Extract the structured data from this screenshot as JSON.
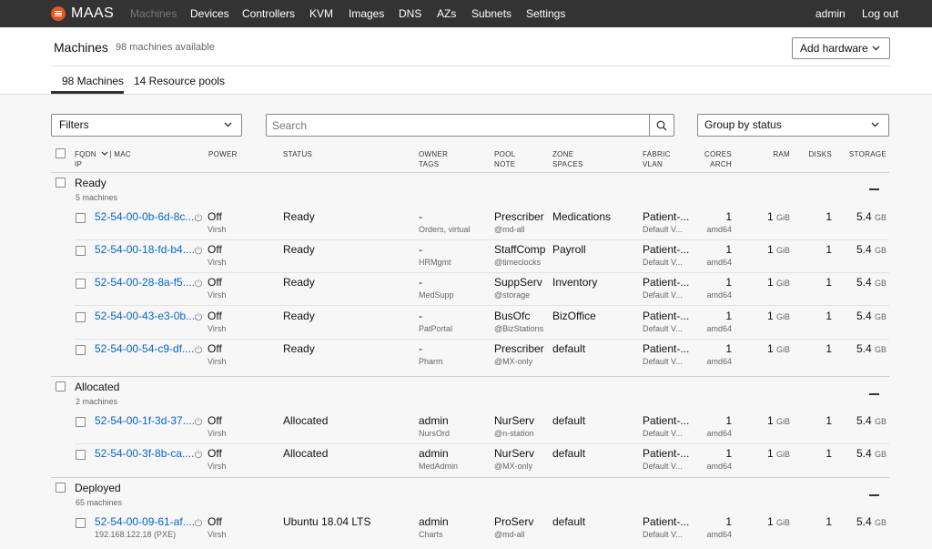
{
  "nav": {
    "brand": "MAAS",
    "links": [
      "Machines",
      "Devices",
      "Controllers",
      "KVM",
      "Images",
      "DNS",
      "AZs",
      "Subnets",
      "Settings"
    ],
    "user": "admin",
    "logout": "Log out"
  },
  "header": {
    "title": "Machines",
    "subtitle": "98 machines available",
    "add_hardware": "Add hardware",
    "tabs": [
      "98 Machines",
      "14 Resource pools"
    ]
  },
  "controls": {
    "filters": "Filters",
    "search_placeholder": "Search",
    "group_by": "Group by status"
  },
  "columns": {
    "fqdn": "FQDN",
    "mac": "| MAC",
    "ip": "IP",
    "power": "POWER",
    "status": "STATUS",
    "owner": "OWNER",
    "tags": "TAGS",
    "pool": "POOL",
    "note": "NOTE",
    "zone": "ZONE",
    "spaces": "SPACES",
    "fabric": "FABRIC",
    "vlan": "VLAN",
    "cores": "CORES",
    "arch": "ARCH",
    "ram": "RAM",
    "disks": "DISKS",
    "storage": "STORAGE"
  },
  "groups": [
    {
      "title": "Ready",
      "count": "5 machines",
      "rows": [
        {
          "fqdn": "52-54-00-0b-6d-8c....",
          "ip": "",
          "power": "Off",
          "power_type": "Virsh",
          "status": "Ready",
          "owner": "-",
          "tags": "Orders, virtual",
          "pool": "Prescriber",
          "note": "@md-all",
          "zone": "Medications",
          "fabric": "Patient-...",
          "vlan": "Default V...",
          "cores": "1",
          "arch": "amd64",
          "ram": "1",
          "ram_unit": "GiB",
          "disks": "1",
          "storage": "5.4",
          "storage_unit": "GB"
        },
        {
          "fqdn": "52-54-00-18-fd-b4....",
          "ip": "",
          "power": "Off",
          "power_type": "Virsh",
          "status": "Ready",
          "owner": "-",
          "tags": "HRMgmt",
          "pool": "StaffComp",
          "note": "@timeclocks",
          "zone": "Payroll",
          "fabric": "Patient-...",
          "vlan": "Default V...",
          "cores": "1",
          "arch": "amd64",
          "ram": "1",
          "ram_unit": "GiB",
          "disks": "1",
          "storage": "5.4",
          "storage_unit": "GB"
        },
        {
          "fqdn": "52-54-00-28-8a-f5....",
          "ip": "",
          "power": "Off",
          "power_type": "Virsh",
          "status": "Ready",
          "owner": "-",
          "tags": "MedSupp",
          "pool": "SuppServ",
          "note": "@storage",
          "zone": "Inventory",
          "fabric": "Patient-...",
          "vlan": "Default V...",
          "cores": "1",
          "arch": "amd64",
          "ram": "1",
          "ram_unit": "GiB",
          "disks": "1",
          "storage": "5.4",
          "storage_unit": "GB"
        },
        {
          "fqdn": "52-54-00-43-e3-0b....",
          "ip": "",
          "power": "Off",
          "power_type": "Virsh",
          "status": "Ready",
          "owner": "-",
          "tags": "PatPortal",
          "pool": "BusOfc",
          "note": "@BizStations",
          "zone": "BizOffice",
          "fabric": "Patient-...",
          "vlan": "Default V...",
          "cores": "1",
          "arch": "amd64",
          "ram": "1",
          "ram_unit": "GiB",
          "disks": "1",
          "storage": "5.4",
          "storage_unit": "GB"
        },
        {
          "fqdn": "52-54-00-54-c9-df....",
          "ip": "",
          "power": "Off",
          "power_type": "Virsh",
          "status": "Ready",
          "owner": "-",
          "tags": "Pharm",
          "pool": "Prescriber",
          "note": "@MX-only",
          "zone": "default",
          "fabric": "Patient-...",
          "vlan": "Default V...",
          "cores": "1",
          "arch": "amd64",
          "ram": "1",
          "ram_unit": "GiB",
          "disks": "1",
          "storage": "5.4",
          "storage_unit": "GB"
        }
      ]
    },
    {
      "title": "Allocated",
      "count": "2 machines",
      "rows": [
        {
          "fqdn": "52-54-00-1f-3d-37....",
          "ip": "",
          "power": "Off",
          "power_type": "Virsh",
          "status": "Allocated",
          "owner": "admin",
          "tags": "NursOrd",
          "pool": "NurServ",
          "note": "@n-station",
          "zone": "default",
          "fabric": "Patient-...",
          "vlan": "Default V...",
          "cores": "1",
          "arch": "amd64",
          "ram": "1",
          "ram_unit": "GiB",
          "disks": "1",
          "storage": "5.4",
          "storage_unit": "GB"
        },
        {
          "fqdn": "52-54-00-3f-8b-ca....",
          "ip": "",
          "power": "Off",
          "power_type": "Virsh",
          "status": "Allocated",
          "owner": "admin",
          "tags": "MedAdmin",
          "pool": "NurServ",
          "note": "@MX-only",
          "zone": "default",
          "fabric": "Patient-...",
          "vlan": "Default V...",
          "cores": "1",
          "arch": "amd64",
          "ram": "1",
          "ram_unit": "GiB",
          "disks": "1",
          "storage": "5.4",
          "storage_unit": "GB"
        }
      ]
    },
    {
      "title": "Deployed",
      "count": "65 machines",
      "rows": [
        {
          "fqdn": "52-54-00-09-61-af....",
          "ip": "192.168.122.18 (PXE)",
          "power": "Off",
          "power_type": "Virsh",
          "status": "Ubuntu 18.04 LTS",
          "owner": "admin",
          "tags": "Charts",
          "pool": "ProServ",
          "note": "@md-all",
          "zone": "default",
          "fabric": "Patient-...",
          "vlan": "Default V...",
          "cores": "1",
          "arch": "amd64",
          "ram": "1",
          "ram_unit": "GiB",
          "disks": "1",
          "storage": "5.4",
          "storage_unit": "GB"
        }
      ]
    }
  ]
}
